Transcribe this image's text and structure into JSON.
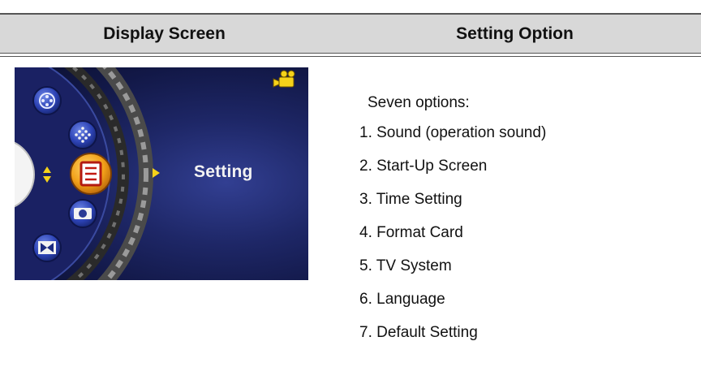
{
  "table": {
    "col_display_header": "Display Screen",
    "col_setting_header": "Setting Option"
  },
  "screen": {
    "menu_label": "Setting",
    "icons": [
      "film-reel-icon",
      "diamond-dots-icon",
      "setting-list-icon",
      "camera-icon",
      "slideshow-icon",
      "video-camera-icon",
      "up-down-arrow-icon",
      "right-arrow-icon"
    ],
    "colors": {
      "background": "#1b2360",
      "highlight": "#f0a11a",
      "arrow": "#f5d21a"
    }
  },
  "options": {
    "intro": "Seven options:",
    "items": [
      "1. Sound (operation sound)",
      "2. Start-Up Screen",
      "3. Time Setting",
      "4. Format Card",
      "5. TV System",
      "6. Language",
      "7. Default Setting"
    ]
  }
}
